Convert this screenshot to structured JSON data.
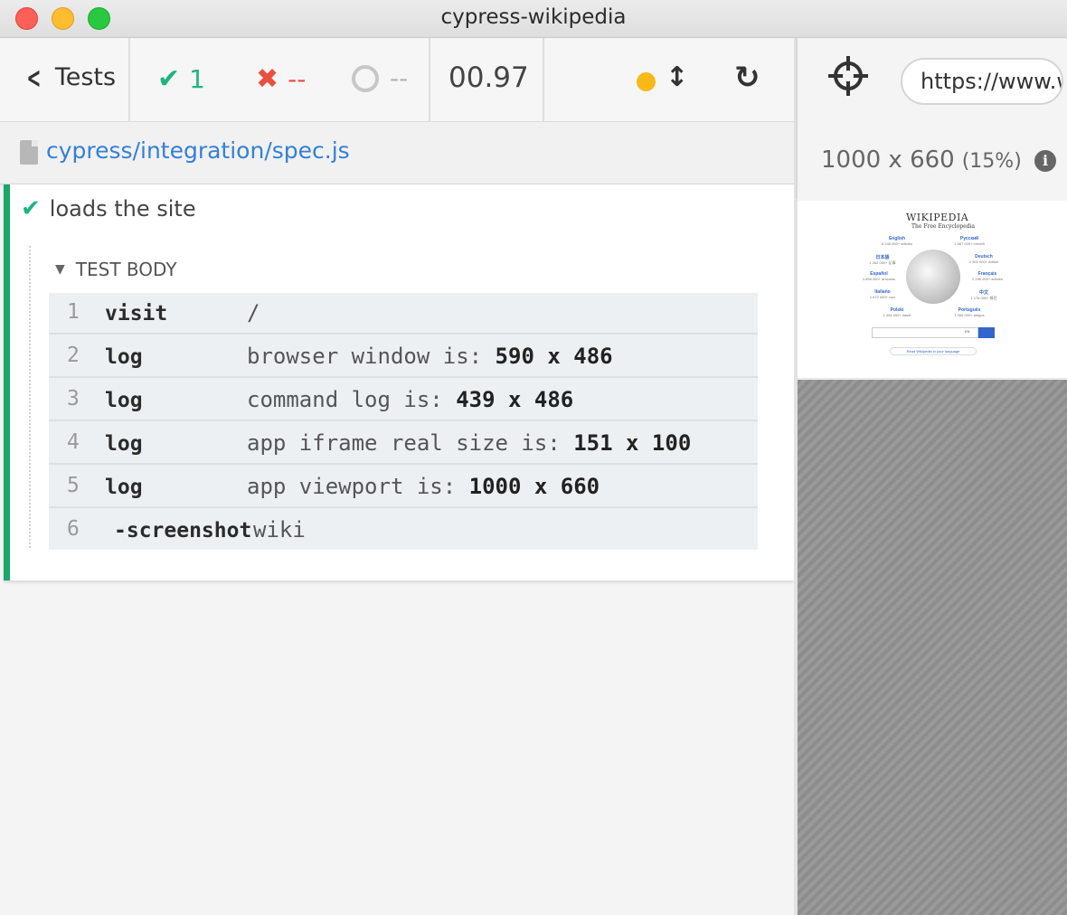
{
  "window": {
    "title": "cypress-wikipedia"
  },
  "header": {
    "tests_label": "Tests",
    "passed": "1",
    "failed": "--",
    "pending": "--",
    "duration": "00.97"
  },
  "spec": {
    "path": "cypress/integration/spec.js"
  },
  "test": {
    "title": "loads the site",
    "section": "TEST BODY",
    "commands": [
      {
        "num": "1",
        "name": "visit",
        "msg": "/",
        "bold": ""
      },
      {
        "num": "2",
        "name": "log",
        "msg": "browser window is: ",
        "bold": "590 x 486"
      },
      {
        "num": "3",
        "name": "log",
        "msg": "command log is: ",
        "bold": "439 x 486"
      },
      {
        "num": "4",
        "name": "log",
        "msg": "app iframe real size is: ",
        "bold": "151 x 100"
      },
      {
        "num": "5",
        "name": "log",
        "msg": "app viewport is: ",
        "bold": "1000 x 660"
      },
      {
        "num": "6",
        "name": "-screenshot",
        "msg": "wiki",
        "bold": ""
      }
    ]
  },
  "aut": {
    "url": "https://www.wikipedia.org/",
    "viewport": "1000 x 660",
    "scale": "(15%)"
  },
  "wiki_preview": {
    "title": "WIKIPEDIA",
    "subtitle": "The Free Encyclopedia",
    "languages": [
      {
        "name": "English",
        "count": "6 245 000+ articles"
      },
      {
        "name": "Русский",
        "count": "1 687 000+ статей"
      },
      {
        "name": "日本語",
        "count": "1 262 000+ 記事"
      },
      {
        "name": "Deutsch",
        "count": "2 502 000+ Artikel"
      },
      {
        "name": "Español",
        "count": "1 658 000+ artículos"
      },
      {
        "name": "Français",
        "count": "2 296 000+ articles"
      },
      {
        "name": "Italiano",
        "count": "1 672 000+ voci"
      },
      {
        "name": "中文",
        "count": "1 176 000+ 條目"
      },
      {
        "name": "Polski",
        "count": "1 454 000+ haseł"
      },
      {
        "name": "Português",
        "count": "1 066 000+ artigos"
      }
    ],
    "search_lang": "EN",
    "read_label": "Read Wikipedia in your language"
  },
  "colors": {
    "pass": "#1eb67f",
    "fail": "#e94f3f",
    "link": "#3380d8",
    "running_dot": "#f8b81a",
    "test_border": "#1aa86a"
  }
}
